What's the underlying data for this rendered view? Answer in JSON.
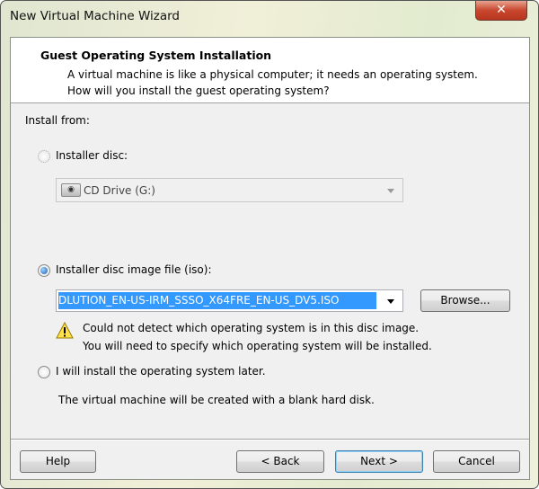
{
  "window": {
    "title": "New Virtual Machine Wizard",
    "close_icon": "close-icon"
  },
  "header": {
    "title": "Guest Operating System Installation",
    "description": "A virtual machine is like a physical computer; it needs an operating system. How will you install the guest operating system?"
  },
  "install_from_label": "Install from:",
  "options": {
    "disc": {
      "label": "Installer disc:",
      "selected": false,
      "enabled": false,
      "drive_value": "CD Drive (G:)"
    },
    "iso": {
      "label": "Installer disc image file (iso):",
      "selected": true,
      "value": "DLUTION_EN-US-IRM_SSSO_X64FRE_EN-US_DV5.ISO",
      "browse_label": "Browse..."
    },
    "warning": {
      "line1": "Could not detect which operating system is in this disc image.",
      "line2": "You will need to specify which operating system will be installed."
    },
    "later": {
      "label": "I will install the operating system later.",
      "selected": false,
      "note": "The virtual machine will be created with a blank hard disk."
    }
  },
  "buttons": {
    "help": "Help",
    "back": "< Back",
    "next": "Next >",
    "cancel": "Cancel"
  }
}
